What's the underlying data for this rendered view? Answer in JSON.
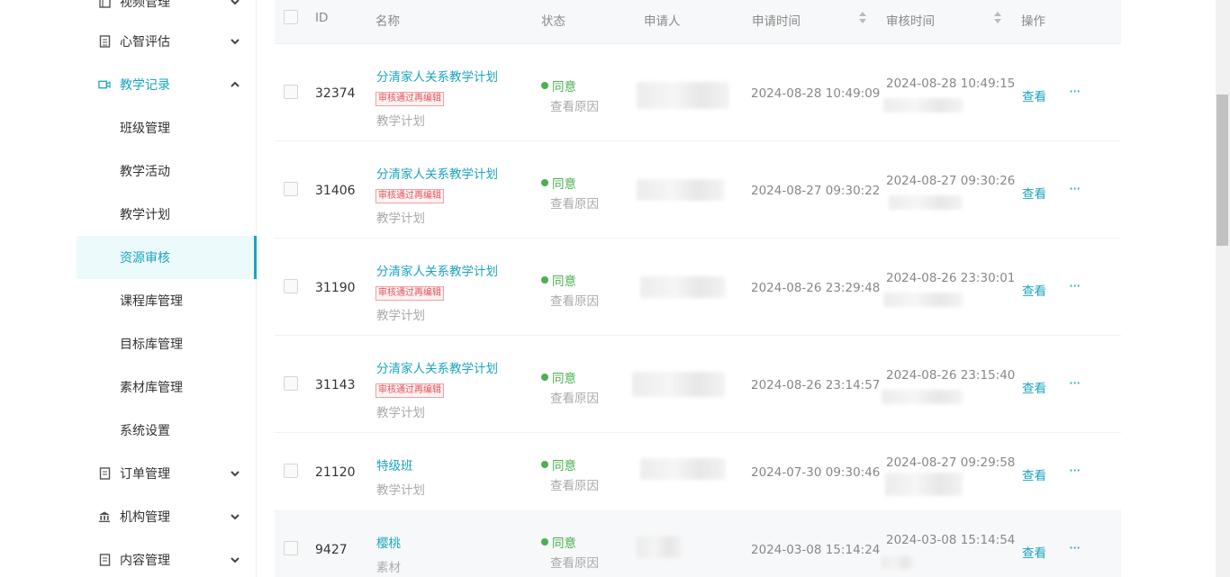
{
  "sidebar": {
    "items": [
      {
        "label": "视频管理",
        "icon": "video-list-icon"
      },
      {
        "label": "心智评估",
        "icon": "clipboard-icon"
      },
      {
        "label": "教学记录",
        "icon": "camera-icon"
      },
      {
        "label": "订单管理",
        "icon": "document-icon"
      },
      {
        "label": "机构管理",
        "icon": "bank-icon"
      },
      {
        "label": "内容管理",
        "icon": "file-icon"
      }
    ],
    "sub_items": [
      "班级管理",
      "教学活动",
      "教学计划",
      "资源审核",
      "课程库管理",
      "目标库管理",
      "素材库管理",
      "系统设置"
    ]
  },
  "table": {
    "headers": {
      "id": "ID",
      "name": "名称",
      "status": "状态",
      "applicant": "申请人",
      "apply_time": "申请时间",
      "review_time": "审核时间",
      "action": "操作"
    },
    "rows": [
      {
        "id": "32374",
        "name": "分清家人关系教学计划",
        "tag": "审核通过再编辑",
        "type": "教学计划",
        "status": "同意",
        "reason": "查看原因",
        "apply_time": "2024-08-28 10:49:09",
        "review_time": "2024-08-28 10:49:15",
        "view": "查看",
        "more": "···"
      },
      {
        "id": "31406",
        "name": "分清家人关系教学计划",
        "tag": "审核通过再编辑",
        "type": "教学计划",
        "status": "同意",
        "reason": "查看原因",
        "apply_time": "2024-08-27 09:30:22",
        "review_time": "2024-08-27 09:30:26",
        "view": "查看",
        "more": "···"
      },
      {
        "id": "31190",
        "name": "分清家人关系教学计划",
        "tag": "审核通过再编辑",
        "type": "教学计划",
        "status": "同意",
        "reason": "查看原因",
        "apply_time": "2024-08-26 23:29:48",
        "review_time": "2024-08-26 23:30:01",
        "view": "查看",
        "more": "···"
      },
      {
        "id": "31143",
        "name": "分清家人关系教学计划",
        "tag": "审核通过再编辑",
        "type": "教学计划",
        "status": "同意",
        "reason": "查看原因",
        "apply_time": "2024-08-26 23:14:57",
        "review_time": "2024-08-26 23:15:40",
        "view": "查看",
        "more": "···"
      },
      {
        "id": "21120",
        "name": "特级班",
        "tag": "",
        "type": "教学计划",
        "status": "同意",
        "reason": "查看原因",
        "apply_time": "2024-07-30 09:30:46",
        "review_time": "2024-08-27 09:29:58",
        "view": "查看",
        "more": "···"
      },
      {
        "id": "9427",
        "name": "樱桃",
        "tag": "",
        "type": "素材",
        "status": "同意",
        "reason": "查看原因",
        "apply_time": "2024-03-08 15:14:24",
        "review_time": "2024-03-08 15:14:54",
        "view": "查看",
        "more": "···"
      }
    ]
  },
  "colors": {
    "accent": "#1aa4c0",
    "success": "#4caf50",
    "tag_red": "#e3525a"
  }
}
